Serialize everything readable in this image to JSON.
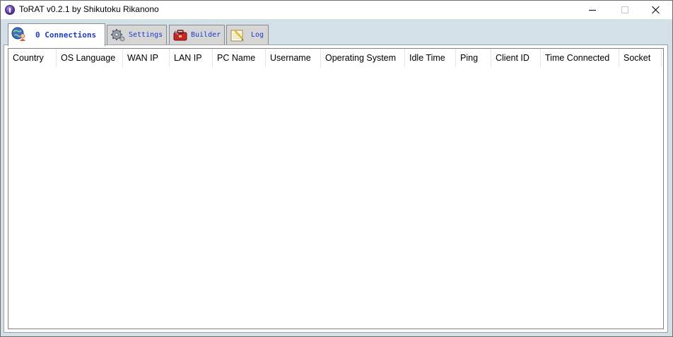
{
  "window": {
    "title": "ToRAT v0.2.1 by Shikutoku Rikanono"
  },
  "tabs": [
    {
      "label": "0 Connections",
      "icon": "globe-user-icon"
    },
    {
      "label": "Settings",
      "icon": "gear-icon"
    },
    {
      "label": "Builder",
      "icon": "toolbox-icon"
    },
    {
      "label": "Log",
      "icon": "notepad-icon"
    }
  ],
  "columns": [
    "Country",
    "OS Language",
    "WAN IP",
    "LAN IP",
    "PC Name",
    "Username",
    "Operating System",
    "Idle Time",
    "Ping",
    "Client ID",
    "Time Connected",
    "Socket"
  ],
  "colors": {
    "tab_text": "#1a3cc8",
    "client_background": "#d4e0e8"
  }
}
